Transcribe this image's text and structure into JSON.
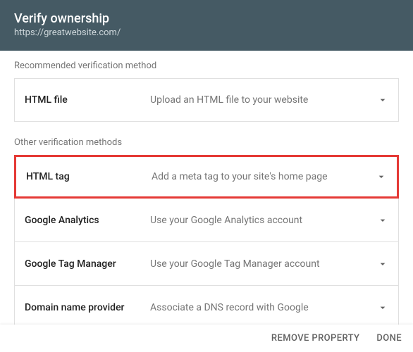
{
  "header": {
    "title": "Verify ownership",
    "url": "https://greatwebsite.com/"
  },
  "recommended": {
    "label": "Recommended verification method",
    "methods": [
      {
        "name": "HTML file",
        "description": "Upload an HTML file to your website",
        "highlight": false
      }
    ]
  },
  "other": {
    "label": "Other verification methods",
    "methods": [
      {
        "name": "HTML tag",
        "description": "Add a meta tag to your site's home page",
        "highlight": true
      },
      {
        "name": "Google Analytics",
        "description": "Use your Google Analytics account",
        "highlight": false
      },
      {
        "name": "Google Tag Manager",
        "description": "Use your Google Tag Manager account",
        "highlight": false
      },
      {
        "name": "Domain name provider",
        "description": "Associate a DNS record with Google",
        "highlight": false
      }
    ]
  },
  "footer": {
    "remove": "REMOVE PROPERTY",
    "done": "DONE"
  }
}
